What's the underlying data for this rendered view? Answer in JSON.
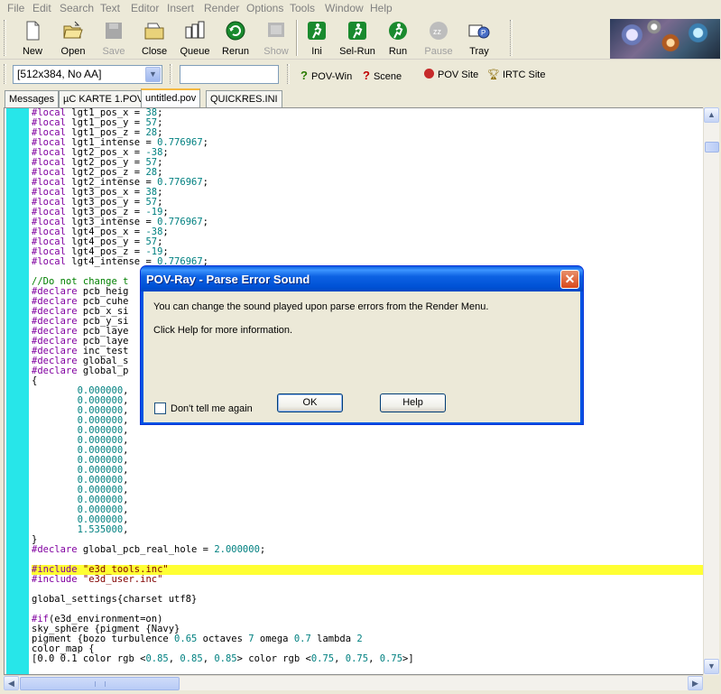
{
  "menu": [
    "File",
    "Edit",
    "Search",
    "Text",
    "Editor",
    "Insert",
    "Render",
    "Options",
    "Tools",
    "Window",
    "Help"
  ],
  "toolbar": {
    "new": "New",
    "open": "Open",
    "save": "Save",
    "close": "Close",
    "queue": "Queue",
    "rerun": "Rerun",
    "show": "Show",
    "ini": "Ini",
    "sel_run": "Sel-Run",
    "run": "Run",
    "pause": "Pause",
    "tray": "Tray"
  },
  "toolbar2": {
    "resolution": "[512x384, No AA]",
    "command_value": "",
    "pov_win": "POV-Win",
    "scene": "Scene",
    "pov_site": "POV Site",
    "irtc_site": "IRTC Site"
  },
  "tabs": [
    "Messages",
    "µC KARTE 1.POV",
    "untitled.pov",
    "QUICKRES.INI"
  ],
  "active_tab": 2,
  "code_lines": [
    [
      [
        "kw",
        "#local "
      ],
      [
        "",
        "lgt1_pos_x = "
      ],
      [
        "num",
        "38"
      ],
      [
        "",
        ";"
      ]
    ],
    [
      [
        "kw",
        "#local "
      ],
      [
        "",
        "lgt1_pos_y = "
      ],
      [
        "num",
        "57"
      ],
      [
        "",
        ";"
      ]
    ],
    [
      [
        "kw",
        "#local "
      ],
      [
        "",
        "lgt1_pos_z = "
      ],
      [
        "num",
        "28"
      ],
      [
        "",
        ";"
      ]
    ],
    [
      [
        "kw",
        "#local "
      ],
      [
        "",
        "lgt1_intense = "
      ],
      [
        "num",
        "0.776967"
      ],
      [
        "",
        ";"
      ]
    ],
    [
      [
        "kw",
        "#local "
      ],
      [
        "",
        "lgt2_pos_x = "
      ],
      [
        "num",
        "-38"
      ],
      [
        "",
        ";"
      ]
    ],
    [
      [
        "kw",
        "#local "
      ],
      [
        "",
        "lgt2_pos_y = "
      ],
      [
        "num",
        "57"
      ],
      [
        "",
        ";"
      ]
    ],
    [
      [
        "kw",
        "#local "
      ],
      [
        "",
        "lgt2_pos_z = "
      ],
      [
        "num",
        "28"
      ],
      [
        "",
        ";"
      ]
    ],
    [
      [
        "kw",
        "#local "
      ],
      [
        "",
        "lgt2_intense = "
      ],
      [
        "num",
        "0.776967"
      ],
      [
        "",
        ";"
      ]
    ],
    [
      [
        "kw",
        "#local "
      ],
      [
        "",
        "lgt3_pos_x = "
      ],
      [
        "num",
        "38"
      ],
      [
        "",
        ";"
      ]
    ],
    [
      [
        "kw",
        "#local "
      ],
      [
        "",
        "lgt3_pos_y = "
      ],
      [
        "num",
        "57"
      ],
      [
        "",
        ";"
      ]
    ],
    [
      [
        "kw",
        "#local "
      ],
      [
        "",
        "lgt3_pos_z = "
      ],
      [
        "num",
        "-19"
      ],
      [
        "",
        ";"
      ]
    ],
    [
      [
        "kw",
        "#local "
      ],
      [
        "",
        "lgt3_intense = "
      ],
      [
        "num",
        "0.776967"
      ],
      [
        "",
        ";"
      ]
    ],
    [
      [
        "kw",
        "#local "
      ],
      [
        "",
        "lgt4_pos_x = "
      ],
      [
        "num",
        "-38"
      ],
      [
        "",
        ";"
      ]
    ],
    [
      [
        "kw",
        "#local "
      ],
      [
        "",
        "lgt4_pos_y = "
      ],
      [
        "num",
        "57"
      ],
      [
        "",
        ";"
      ]
    ],
    [
      [
        "kw",
        "#local "
      ],
      [
        "",
        "lgt4_pos_z = "
      ],
      [
        "num",
        "-19"
      ],
      [
        "",
        ";"
      ]
    ],
    [
      [
        "kw",
        "#local "
      ],
      [
        "",
        "lgt4_intense = "
      ],
      [
        "num",
        "0.776967"
      ],
      [
        "",
        ";"
      ]
    ],
    [],
    [
      [
        "cm",
        "//Do not change t"
      ]
    ],
    [
      [
        "kw",
        "#declare "
      ],
      [
        "",
        "pcb_heig"
      ]
    ],
    [
      [
        "kw",
        "#declare "
      ],
      [
        "",
        "pcb_cuhe"
      ]
    ],
    [
      [
        "kw",
        "#declare "
      ],
      [
        "",
        "pcb_x_si"
      ]
    ],
    [
      [
        "kw",
        "#declare "
      ],
      [
        "",
        "pcb_y_si"
      ]
    ],
    [
      [
        "kw",
        "#declare "
      ],
      [
        "",
        "pcb_laye"
      ]
    ],
    [
      [
        "kw",
        "#declare "
      ],
      [
        "",
        "pcb_laye"
      ]
    ],
    [
      [
        "kw",
        "#declare "
      ],
      [
        "",
        "inc_test"
      ]
    ],
    [
      [
        "kw",
        "#declare "
      ],
      [
        "",
        "global_s"
      ]
    ],
    [
      [
        "kw",
        "#declare "
      ],
      [
        "",
        "global_p"
      ]
    ],
    [
      [
        "",
        "{"
      ]
    ],
    [
      [
        "",
        "        "
      ],
      [
        "num",
        "0.000000"
      ],
      [
        "",
        ","
      ]
    ],
    [
      [
        "",
        "        "
      ],
      [
        "num",
        "0.000000"
      ],
      [
        "",
        ","
      ]
    ],
    [
      [
        "",
        "        "
      ],
      [
        "num",
        "0.000000"
      ],
      [
        "",
        ","
      ]
    ],
    [
      [
        "",
        "        "
      ],
      [
        "num",
        "0.000000"
      ],
      [
        "",
        ","
      ]
    ],
    [
      [
        "",
        "        "
      ],
      [
        "num",
        "0.000000"
      ],
      [
        "",
        ","
      ]
    ],
    [
      [
        "",
        "        "
      ],
      [
        "num",
        "0.000000"
      ],
      [
        "",
        ","
      ]
    ],
    [
      [
        "",
        "        "
      ],
      [
        "num",
        "0.000000"
      ],
      [
        "",
        ","
      ]
    ],
    [
      [
        "",
        "        "
      ],
      [
        "num",
        "0.000000"
      ],
      [
        "",
        ","
      ]
    ],
    [
      [
        "",
        "        "
      ],
      [
        "num",
        "0.000000"
      ],
      [
        "",
        ","
      ]
    ],
    [
      [
        "",
        "        "
      ],
      [
        "num",
        "0.000000"
      ],
      [
        "",
        ","
      ]
    ],
    [
      [
        "",
        "        "
      ],
      [
        "num",
        "0.000000"
      ],
      [
        "",
        ","
      ]
    ],
    [
      [
        "",
        "        "
      ],
      [
        "num",
        "0.000000"
      ],
      [
        "",
        ","
      ]
    ],
    [
      [
        "",
        "        "
      ],
      [
        "num",
        "0.000000"
      ],
      [
        "",
        ","
      ]
    ],
    [
      [
        "",
        "        "
      ],
      [
        "num",
        "0.000000"
      ],
      [
        "",
        ","
      ]
    ],
    [
      [
        "",
        "        "
      ],
      [
        "num",
        "1.535000"
      ],
      [
        "",
        ","
      ]
    ],
    [
      [
        "",
        "}"
      ]
    ],
    [
      [
        "kw",
        "#declare "
      ],
      [
        "",
        "global_pcb_real_hole = "
      ],
      [
        "num",
        "2.000000"
      ],
      [
        "",
        ";"
      ]
    ],
    [],
    [
      [
        "kw",
        "#include "
      ],
      [
        "str",
        "\"e3d_tools.inc\""
      ]
    ],
    [
      [
        "kw",
        "#include "
      ],
      [
        "str",
        "\"e3d_user.inc\""
      ]
    ],
    [],
    [
      [
        "",
        "global_settings{charset utf8}"
      ]
    ],
    [],
    [
      [
        "kw",
        "#if"
      ],
      [
        "",
        "(e3d_environment=on)"
      ]
    ],
    [
      [
        "",
        "sky_sphere {pigment {Navy}"
      ]
    ],
    [
      [
        "",
        "pigment {bozo turbulence "
      ],
      [
        "num",
        "0.65"
      ],
      [
        "",
        " octaves "
      ],
      [
        "num",
        "7"
      ],
      [
        "",
        " omega "
      ],
      [
        "num",
        "0.7"
      ],
      [
        "",
        " lambda "
      ],
      [
        "num",
        "2"
      ]
    ],
    [
      [
        "",
        "color_map {"
      ]
    ],
    [
      [
        "",
        "[0.0 0.1 color rgb <"
      ],
      [
        "num",
        "0.85"
      ],
      [
        "",
        ", "
      ],
      [
        "num",
        "0.85"
      ],
      [
        "",
        ", "
      ],
      [
        "num",
        "0.85"
      ],
      [
        "",
        "> color rgb <"
      ],
      [
        "num",
        "0.75"
      ],
      [
        "",
        ", "
      ],
      [
        "num",
        "0.75"
      ],
      [
        "",
        ", "
      ],
      [
        "num",
        "0.75"
      ],
      [
        "",
        ">]"
      ]
    ]
  ],
  "highlight_line": 46,
  "dialog": {
    "title": "POV-Ray - Parse Error Sound",
    "message1": "You can change the sound played upon parse errors from the Render Menu.",
    "message2": "Click Help for more information.",
    "checkbox_label": "Don't tell me again",
    "ok": "OK",
    "help": "Help"
  }
}
